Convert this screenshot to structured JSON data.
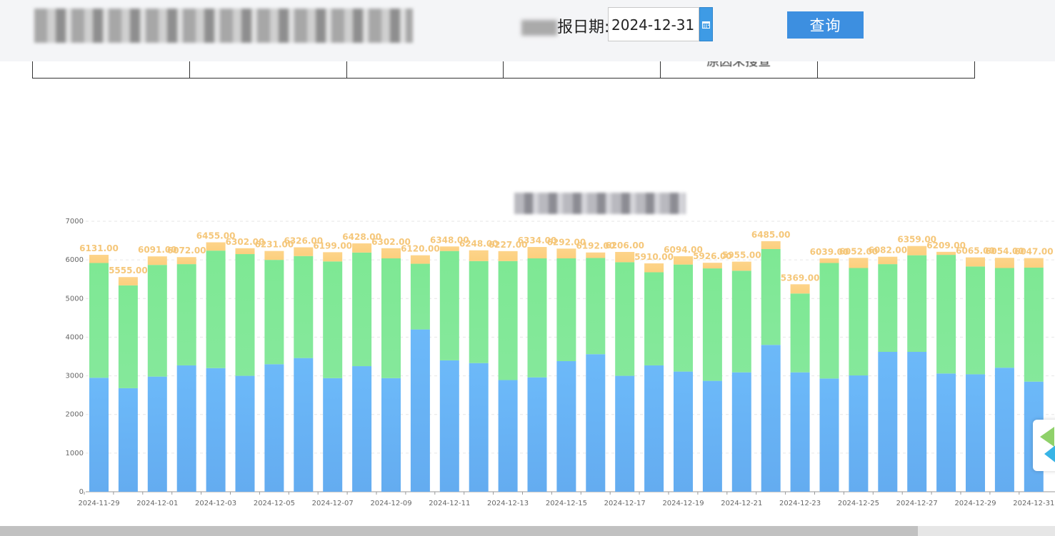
{
  "header": {
    "date_label": "报日期:",
    "date_value": "2024-12-31",
    "query_label": "查询",
    "table_partial_text": "原因未搜查"
  },
  "colors": {
    "bottom": "#6cb9f9",
    "middle": "#85e89b",
    "top": "#fccf7e",
    "label": "#f5c77a"
  },
  "icons": {
    "calendar": "calendar-icon",
    "widget": "floating-widget-icon"
  },
  "chart_data": {
    "type": "bar",
    "stacked": true,
    "categories": [
      "2024-11-29",
      "2024-11-30",
      "2024-12-01",
      "2024-12-02",
      "2024-12-03",
      "2024-12-04",
      "2024-12-05",
      "2024-12-06",
      "2024-12-07",
      "2024-12-08",
      "2024-12-09",
      "2024-12-10",
      "2024-12-11",
      "2024-12-12",
      "2024-12-13",
      "2024-12-14",
      "2024-12-15",
      "2024-12-16",
      "2024-12-17",
      "2024-12-18",
      "2024-12-19",
      "2024-12-20",
      "2024-12-21",
      "2024-12-22",
      "2024-12-23",
      "2024-12-24",
      "2024-12-25",
      "2024-12-26",
      "2024-12-27",
      "2024-12-28",
      "2024-12-29",
      "2024-12-30",
      "2024-12-31"
    ],
    "tick_labels": [
      "2024-11-29",
      "2024-12-01",
      "2024-12-03",
      "2024-12-05",
      "2024-12-07",
      "2024-12-09",
      "2024-12-11",
      "2024-12-13",
      "2024-12-15",
      "2024-12-17",
      "2024-12-19",
      "2024-12-21",
      "2024-12-23",
      "2024-12-25",
      "2024-12-27",
      "2024-12-29",
      "2024-12-31"
    ],
    "series": [
      {
        "values": [
          2950,
          2680,
          2980,
          3270,
          3200,
          3000,
          3300,
          3460,
          2940,
          3250,
          2940,
          4200,
          3400,
          3330,
          2890,
          2960,
          3380,
          3560,
          3000,
          3270,
          3110,
          2870,
          3090,
          3800,
          3090,
          2930,
          3010,
          3620,
          3620,
          3060,
          3040,
          3210,
          2850
        ]
      },
      {
        "values": [
          2970,
          2660,
          2890,
          2620,
          3040,
          3150,
          2700,
          2640,
          3020,
          2940,
          3100,
          1700,
          2830,
          2640,
          3080,
          3080,
          2660,
          2490,
          2940,
          2410,
          2770,
          2910,
          2630,
          2480,
          2040,
          2990,
          2780,
          2270,
          2500,
          3070,
          2790,
          2580,
          2950
        ]
      },
      {
        "values": [
          211,
          215,
          221,
          182,
          215,
          152,
          231,
          226,
          239,
          238,
          262,
          220,
          118,
          278,
          257,
          294,
          252,
          142,
          266,
          230,
          214,
          146,
          235,
          205,
          239,
          119,
          262,
          192,
          239,
          79,
          235,
          264,
          247
        ]
      }
    ],
    "totals": [
      "6131.00",
      "5555.00",
      "6091.00",
      "6072.00",
      "6455.00",
      "6302.00",
      "6231.00",
      "6326.00",
      "6199.00",
      "6428.00",
      "6302.00",
      "6120.00",
      "6348.00",
      "6248.00",
      "6227.00",
      "6334.00",
      "6292.00",
      "6192.00",
      "6206.00",
      "5910.00",
      "6094.00",
      "5926.00",
      "5955.00",
      "6485.00",
      "5369.00",
      "6039.00",
      "6052.00",
      "6082.00",
      "6359.00",
      "6209.00",
      "6065.00",
      "6054.00",
      "6047.00"
    ],
    "ylim": [
      0,
      7000
    ],
    "yticks": [
      0,
      1000,
      2000,
      3000,
      4000,
      5000,
      6000,
      7000
    ],
    "grid": true
  }
}
